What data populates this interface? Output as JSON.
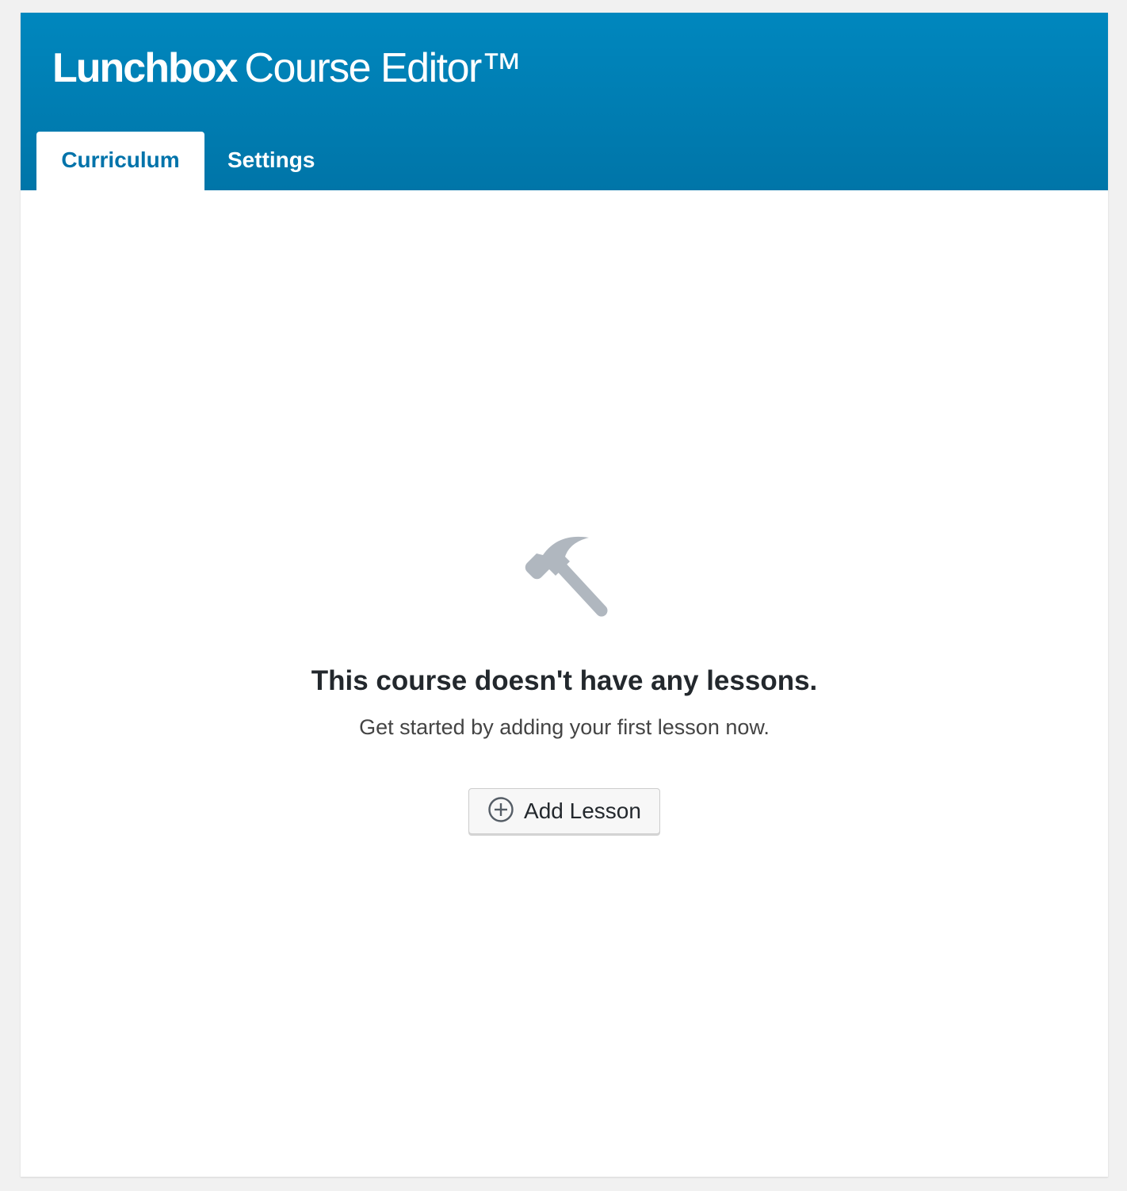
{
  "app": {
    "brand": "Lunchbox",
    "product": "Course Editor™"
  },
  "tabs": [
    {
      "label": "Curriculum",
      "active": true
    },
    {
      "label": "Settings",
      "active": false
    }
  ],
  "empty_state": {
    "icon": "hammer-icon",
    "title": "This course doesn't have any lessons.",
    "subtitle": "Get started by adding your first lesson now."
  },
  "actions": {
    "add_lesson_label": "Add Lesson",
    "add_lesson_icon": "plus-circle-icon"
  },
  "colors": {
    "header": "#0087be",
    "accent": "#0073aa",
    "icon_gray": "#b0b7bf"
  }
}
